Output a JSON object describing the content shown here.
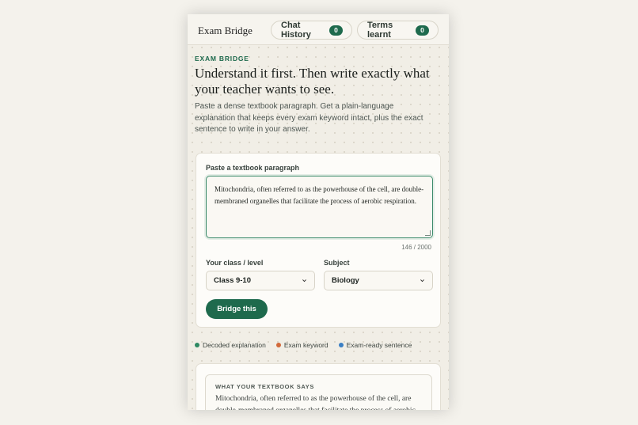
{
  "header": {
    "brand": "Exam Bridge",
    "chat_history_label": "Chat History",
    "chat_history_count": "0",
    "terms_label": "Terms learnt",
    "terms_count": "0"
  },
  "hero": {
    "eyebrow": "EXAM BRIDGE",
    "headline": "Understand it first. Then write exactly what your teacher wants to see.",
    "subtitle": "Paste a dense textbook paragraph. Get a plain-language explanation that keeps every exam keyword intact, plus the exact sentence to write in your answer."
  },
  "form": {
    "paragraph_label": "Paste a textbook paragraph",
    "paragraph_value": "Mitochondria, often referred to as the powerhouse of the cell, are double-membraned organelles that facilitate the process of aerobic respiration.",
    "char_counter": "146 / 2000",
    "class_label": "Your class / level",
    "class_value": "Class 9-10",
    "subject_label": "Subject",
    "subject_value": "Biology",
    "submit_label": "Bridge this"
  },
  "legend": [
    {
      "label": "Decoded explanation",
      "color": "#2e8a63"
    },
    {
      "label": "Exam keyword",
      "color": "#d2693a"
    },
    {
      "label": "Exam-ready sentence",
      "color": "#3b7fc4"
    }
  ],
  "result": {
    "eyebrow": "WHAT YOUR TEXTBOOK SAYS",
    "text": "Mitochondria, often referred to as the powerhouse of the cell, are double-membraned organelles that facilitate the process of aerobic respiration."
  }
}
